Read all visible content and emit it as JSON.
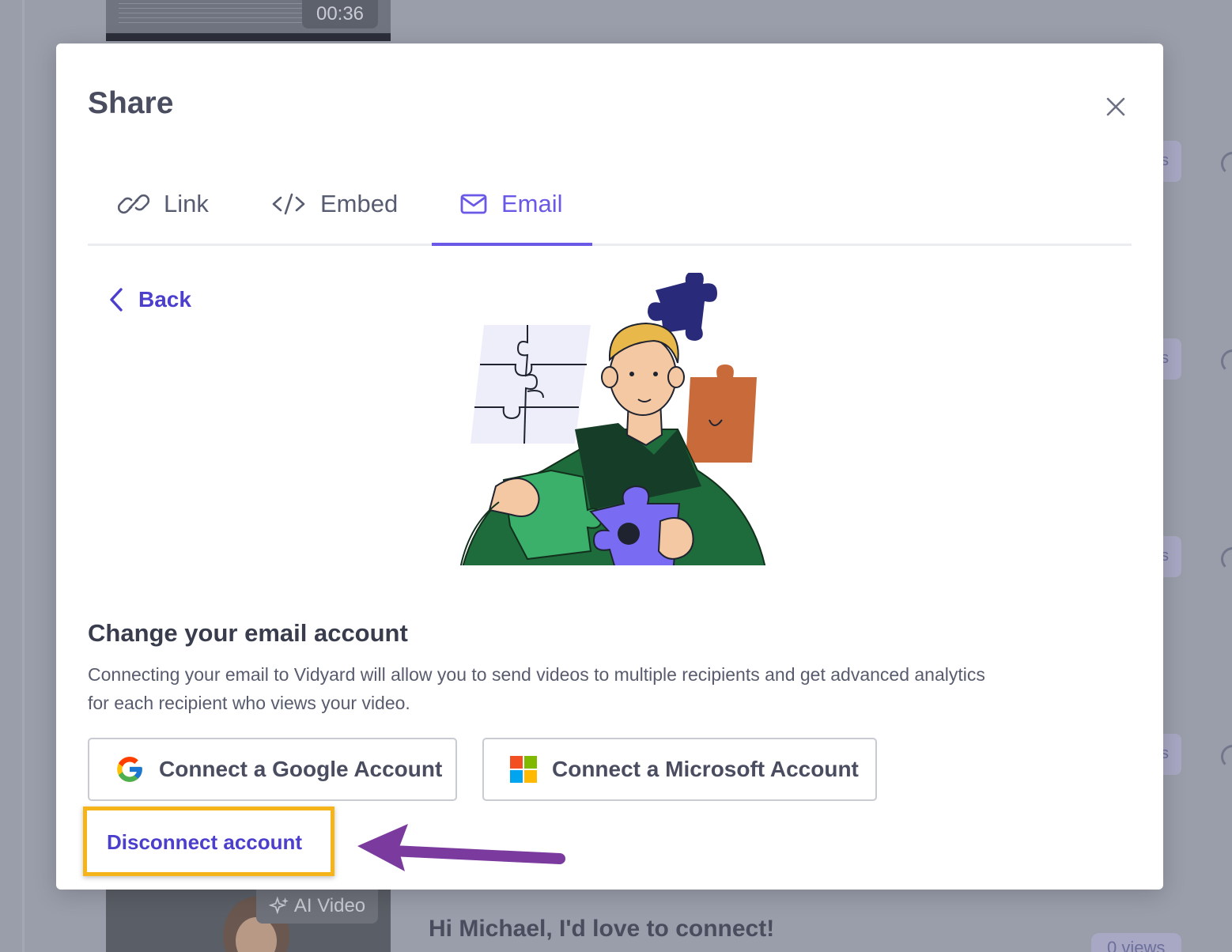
{
  "background": {
    "video_duration": "00:36",
    "ai_badge": "AI Video",
    "video_title": "Hi Michael, I'd love to connect!",
    "views_badge": "0 views",
    "chip_text": "s"
  },
  "modal": {
    "title": "Share",
    "close_icon": "close-icon",
    "tabs": [
      {
        "label": "Link",
        "icon": "link-icon",
        "active": false
      },
      {
        "label": "Embed",
        "icon": "code-icon",
        "active": false
      },
      {
        "label": "Email",
        "icon": "mail-icon",
        "active": true
      }
    ],
    "back_label": "Back",
    "illustration": "person-holding-puzzle-pieces",
    "section_title": "Change your email account",
    "section_description": "Connecting your email to Vidyard will allow you to send videos to multiple recipients and get advanced analytics for each recipient who views your video.",
    "google_button_label": "Connect a Google Account",
    "microsoft_button_label": "Connect a Microsoft Account",
    "disconnect_label": "Disconnect account"
  },
  "colors": {
    "accent": "#6a59e6",
    "link": "#4d3fce",
    "highlight_box": "#f5b41a",
    "annotation_arrow": "#7b3a9e",
    "overlay": "#9a9eaa"
  }
}
